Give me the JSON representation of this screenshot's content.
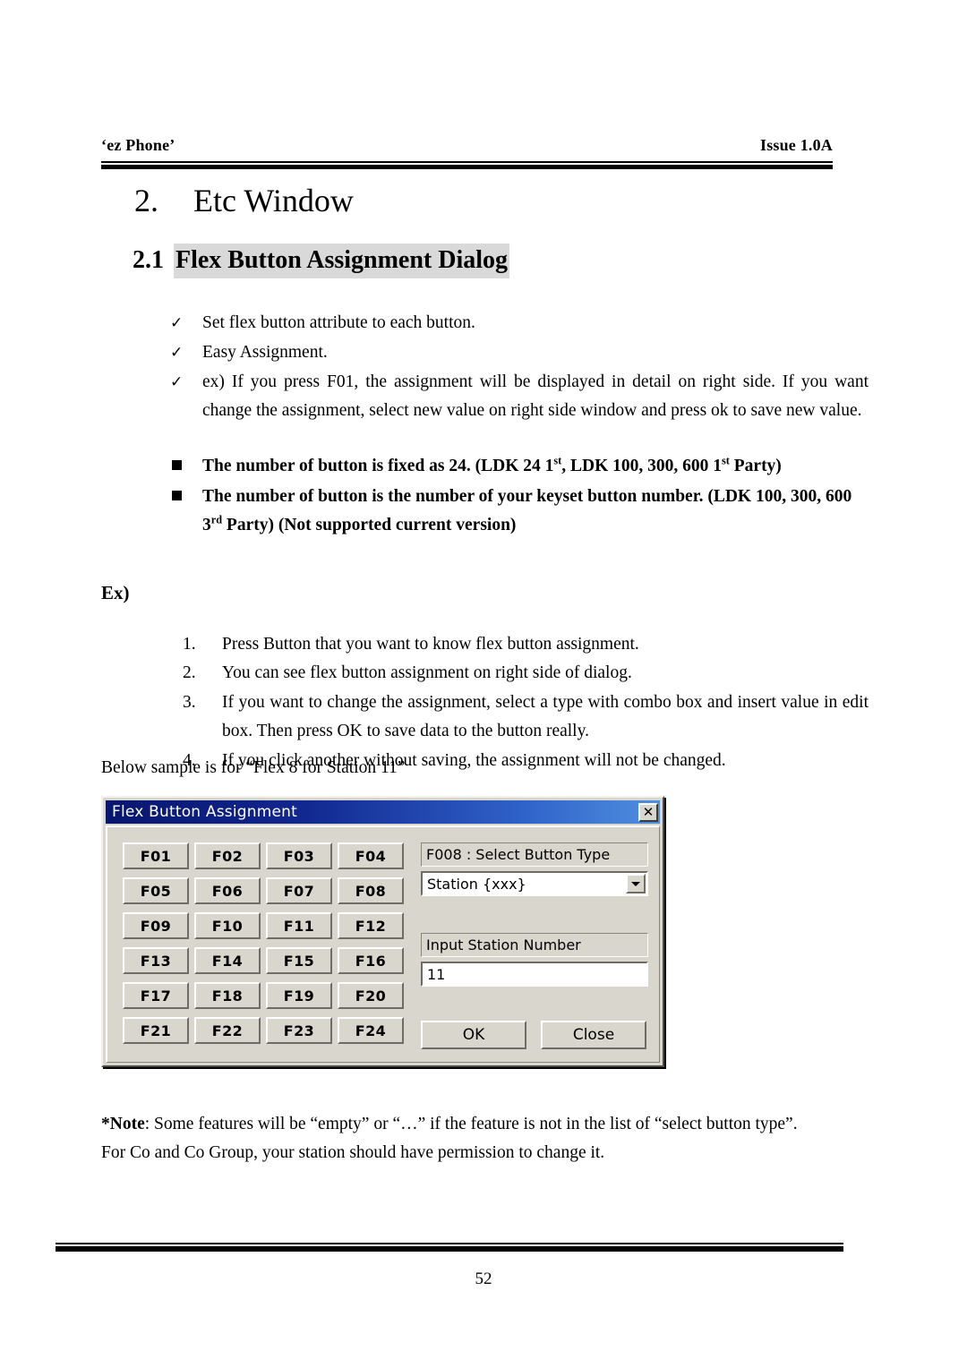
{
  "header": {
    "left": "‘ez Phone’",
    "right": "Issue 1.0A"
  },
  "heading1": {
    "number": "2.",
    "text": "Etc Window"
  },
  "heading2": {
    "number": "2.1",
    "text": "Flex Button Assignment Dialog",
    "highlight_color": "#d9d9d9"
  },
  "check_bullets": {
    "mark": "check-mark",
    "mark_glyph": "✓",
    "items": [
      "Set flex button attribute to each button.",
      "Easy Assignment.",
      "ex) If you press F01, the assignment will be displayed in detail on right side. If you want change the assignment, select new value on right side window and press ok to save new value."
    ]
  },
  "bold_bullets": {
    "mark": "square-bullet",
    "items": [
      {
        "parts": [
          {
            "t": "The number of button is fixed as 24. (LDK 24 1"
          },
          {
            "t": "st",
            "sup": true
          },
          {
            "t": ", LDK 100, 300, 600 1"
          },
          {
            "t": "st",
            "sup": true
          },
          {
            "t": " Party)"
          }
        ]
      },
      {
        "parts": [
          {
            "t": "The number of button is the number of your keyset button number. (LDK 100, 300, 600 3"
          },
          {
            "t": "rd",
            "sup": true
          },
          {
            "t": " Party) (Not supported current version)"
          }
        ]
      }
    ]
  },
  "example": {
    "label": "Ex)",
    "steps": [
      {
        "num": "1.",
        "text": "Press Button that you want to know flex button assignment."
      },
      {
        "num": "2.",
        "text": "You can see flex button assignment on right side of dialog."
      },
      {
        "num": "3.",
        "text": "If you want to change the assignment, select a type with combo box and insert value in edit box. Then press OK to save data to the button really."
      },
      {
        "num": "4.",
        "text": "If you click another without saving, the assignment will not be changed."
      }
    ],
    "caption": "Below sample is for “Flex 8 for Station 11”"
  },
  "dialog": {
    "title": "Flex Button Assignment",
    "close_label": "✕",
    "titlebar_gradient_start": "#08166e",
    "titlebar_gradient_end": "#4f8fe0",
    "face_color": "#d9d6cd",
    "flex_buttons": [
      "F01",
      "F02",
      "F03",
      "F04",
      "F05",
      "F06",
      "F07",
      "F08",
      "F09",
      "F10",
      "F11",
      "F12",
      "F13",
      "F14",
      "F15",
      "F16",
      "F17",
      "F18",
      "F19",
      "F20",
      "F21",
      "F22",
      "F23",
      "F24"
    ],
    "select_button_type_label": "F008 : Select Button Type",
    "button_type_value": "Station {xxx}",
    "input_station_label": "Input Station Number",
    "station_number_value": "11",
    "ok_label": "OK",
    "close_button_label": "Close"
  },
  "note": {
    "prefix": "*Note",
    "line1": ": Some features will be “empty” or “…” if the feature is not in the list of “select button type”.",
    "line2": "For Co and Co Group, your station should have permission to change it."
  },
  "footer": {
    "page_number": "52"
  }
}
